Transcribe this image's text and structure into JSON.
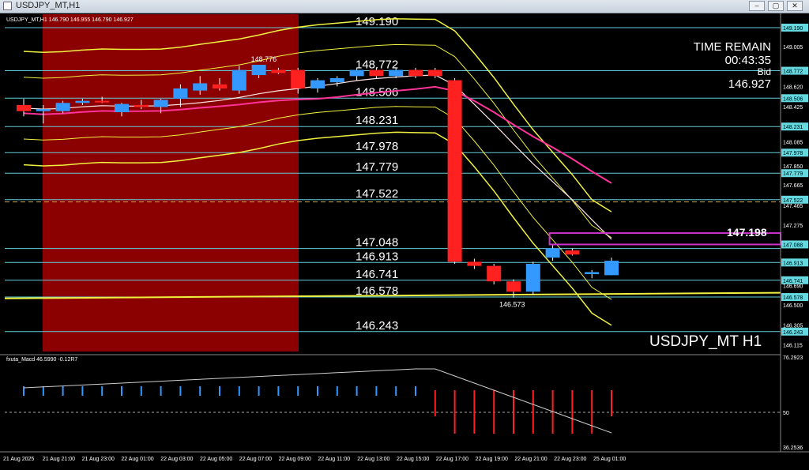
{
  "window": {
    "title": "USDJPY_MT,H1",
    "minimize": "–",
    "restore": "▢",
    "close": "✕"
  },
  "chart_info": "USDJPY_MT,H1  146.790 146.955 146.790 146.927",
  "symbol_watermark": "USDJPY_MT H1",
  "time_remain": {
    "label": "TIME REMAIN",
    "value": "00:43:35",
    "bid_label": "Bid",
    "bid_value": "146.927"
  },
  "indicator_label": "fxuta_Macd 46.5990  -0.12R7",
  "colors": {
    "bg": "#000000",
    "bull": "#3399ff",
    "bear": "#ff2020",
    "session": "#8b0000",
    "level_line": "#66ccd8",
    "band": "#f0f040",
    "ma_pink": "#ff3399",
    "box": "#cc33cc"
  },
  "chart_data": {
    "type": "candlestick",
    "ylim": [
      146.05,
      149.32
    ],
    "price_axis": [
      "149.190",
      "149.005",
      "148.772",
      "148.620",
      "148.506",
      "148.425",
      "148.231",
      "148.085",
      "147.978",
      "147.850",
      "147.779",
      "147.665",
      "147.522",
      "147.465",
      "147.275",
      "147.088",
      "146.913",
      "146.690",
      "146.741",
      "146.578",
      "146.500",
      "146.305",
      "146.243",
      "146.115"
    ],
    "highlighted_ticks": [
      "149.190",
      "148.772",
      "148.506",
      "148.231",
      "147.978",
      "147.779",
      "147.522",
      "147.088",
      "146.913",
      "146.741",
      "146.578",
      "146.243"
    ],
    "levels": [
      {
        "price": 149.19,
        "label": "149.190"
      },
      {
        "price": 148.772,
        "label": "148.772"
      },
      {
        "price": 148.506,
        "label": "148.506"
      },
      {
        "price": 148.231,
        "label": "148.231"
      },
      {
        "price": 147.978,
        "label": "147.978"
      },
      {
        "price": 147.779,
        "label": "147.779"
      },
      {
        "price": 147.522,
        "label": "147.522"
      },
      {
        "price": 147.048,
        "label": "147.048"
      },
      {
        "price": 146.913,
        "label": "146.913"
      },
      {
        "price": 146.741,
        "label": "146.741"
      },
      {
        "price": 146.578,
        "label": "146.578"
      },
      {
        "price": 146.243,
        "label": "146.243"
      }
    ],
    "candles": [
      {
        "o": 148.44,
        "h": 148.5,
        "l": 148.33,
        "c": 148.38
      },
      {
        "o": 148.38,
        "h": 148.44,
        "l": 148.26,
        "c": 148.4
      },
      {
        "o": 148.38,
        "h": 148.48,
        "l": 148.36,
        "c": 148.46
      },
      {
        "o": 148.46,
        "h": 148.5,
        "l": 148.44,
        "c": 148.48
      },
      {
        "o": 148.48,
        "h": 148.52,
        "l": 148.46,
        "c": 148.47
      },
      {
        "o": 148.37,
        "h": 148.46,
        "l": 148.33,
        "c": 148.45
      },
      {
        "o": 148.44,
        "h": 148.49,
        "l": 148.4,
        "c": 148.42
      },
      {
        "o": 148.42,
        "h": 148.5,
        "l": 148.36,
        "c": 148.49
      },
      {
        "o": 148.5,
        "h": 148.64,
        "l": 148.42,
        "c": 148.6
      },
      {
        "o": 148.58,
        "h": 148.72,
        "l": 148.54,
        "c": 148.65
      },
      {
        "o": 148.64,
        "h": 148.7,
        "l": 148.58,
        "c": 148.6
      },
      {
        "o": 148.58,
        "h": 148.82,
        "l": 148.55,
        "c": 148.78
      },
      {
        "o": 148.73,
        "h": 148.776,
        "l": 148.7,
        "c": 148.83
      },
      {
        "o": 148.78,
        "h": 148.8,
        "l": 148.74,
        "c": 148.75
      },
      {
        "o": 148.78,
        "h": 148.8,
        "l": 148.55,
        "c": 148.6
      },
      {
        "o": 148.6,
        "h": 148.7,
        "l": 148.56,
        "c": 148.68
      },
      {
        "o": 148.66,
        "h": 148.72,
        "l": 148.62,
        "c": 148.7
      },
      {
        "o": 148.72,
        "h": 148.8,
        "l": 148.68,
        "c": 148.78
      },
      {
        "o": 148.78,
        "h": 148.8,
        "l": 148.7,
        "c": 148.72
      },
      {
        "o": 148.72,
        "h": 148.8,
        "l": 148.7,
        "c": 148.78
      },
      {
        "o": 148.78,
        "h": 148.8,
        "l": 148.7,
        "c": 148.72
      },
      {
        "o": 148.78,
        "h": 148.8,
        "l": 148.7,
        "c": 148.72
      },
      {
        "o": 148.68,
        "h": 148.7,
        "l": 146.9,
        "c": 146.92
      },
      {
        "o": 146.92,
        "h": 146.95,
        "l": 146.85,
        "c": 146.88
      },
      {
        "o": 146.88,
        "h": 146.9,
        "l": 146.7,
        "c": 146.73
      },
      {
        "o": 146.73,
        "h": 146.75,
        "l": 146.573,
        "c": 146.63
      },
      {
        "o": 146.63,
        "h": 146.92,
        "l": 146.6,
        "c": 146.9
      },
      {
        "o": 146.96,
        "h": 147.08,
        "l": 146.93,
        "c": 147.05
      },
      {
        "o": 147.03,
        "h": 147.05,
        "l": 146.98,
        "c": 146.99
      },
      {
        "o": 146.8,
        "h": 146.84,
        "l": 146.76,
        "c": 146.82
      },
      {
        "o": 146.79,
        "h": 146.96,
        "l": 146.79,
        "c": 146.93
      }
    ],
    "high_marker": {
      "index": 12,
      "label": "148.776"
    },
    "low_marker": {
      "index": 25,
      "label": "146.573"
    },
    "target_box": {
      "label": "147.198",
      "from_index": 27,
      "price_top": 147.198,
      "price_bottom": 147.088
    },
    "time_axis": [
      "21 Aug 2025",
      "21 Aug 21:00",
      "21 Aug 23:00",
      "22 Aug 01:00",
      "22 Aug 03:00",
      "22 Aug 05:00",
      "22 Aug 07:00",
      "22 Aug 09:00",
      "22 Aug 11:00",
      "22 Aug 13:00",
      "22 Aug 15:00",
      "22 Aug 17:00",
      "22 Aug 19:00",
      "22 Aug 21:00",
      "22 Aug 23:00",
      "25 Aug 01:00"
    ],
    "macd_axis": [
      "76.2923",
      "50",
      "36.2536"
    ],
    "macd_hist": [
      0,
      0,
      0,
      0,
      0,
      0,
      0,
      0,
      0,
      0,
      0,
      0,
      0,
      0,
      0,
      0,
      0,
      0,
      0,
      0,
      0,
      -0.6,
      -1,
      -1,
      -1,
      -1,
      -1,
      -1,
      -1,
      -1,
      -0.6
    ]
  }
}
